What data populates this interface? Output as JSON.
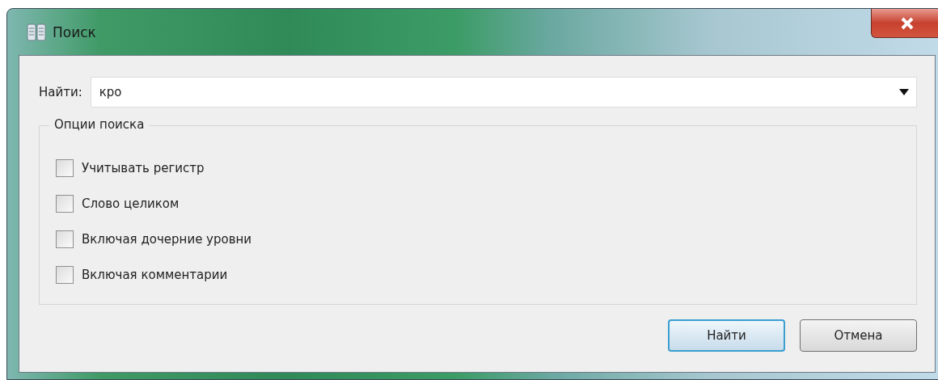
{
  "window": {
    "title": "Поиск"
  },
  "find": {
    "label": "Найти:",
    "value": "кро"
  },
  "options": {
    "title": "Опции поиска",
    "items": [
      {
        "label": "Учитывать регистр",
        "checked": false
      },
      {
        "label": "Слово целиком",
        "checked": false
      },
      {
        "label": "Включая дочерние уровни",
        "checked": false
      },
      {
        "label": "Включая комментарии",
        "checked": false
      }
    ]
  },
  "buttons": [
    {
      "label": "Найти",
      "default": true
    },
    {
      "label": "Отмена",
      "default": false
    }
  ]
}
